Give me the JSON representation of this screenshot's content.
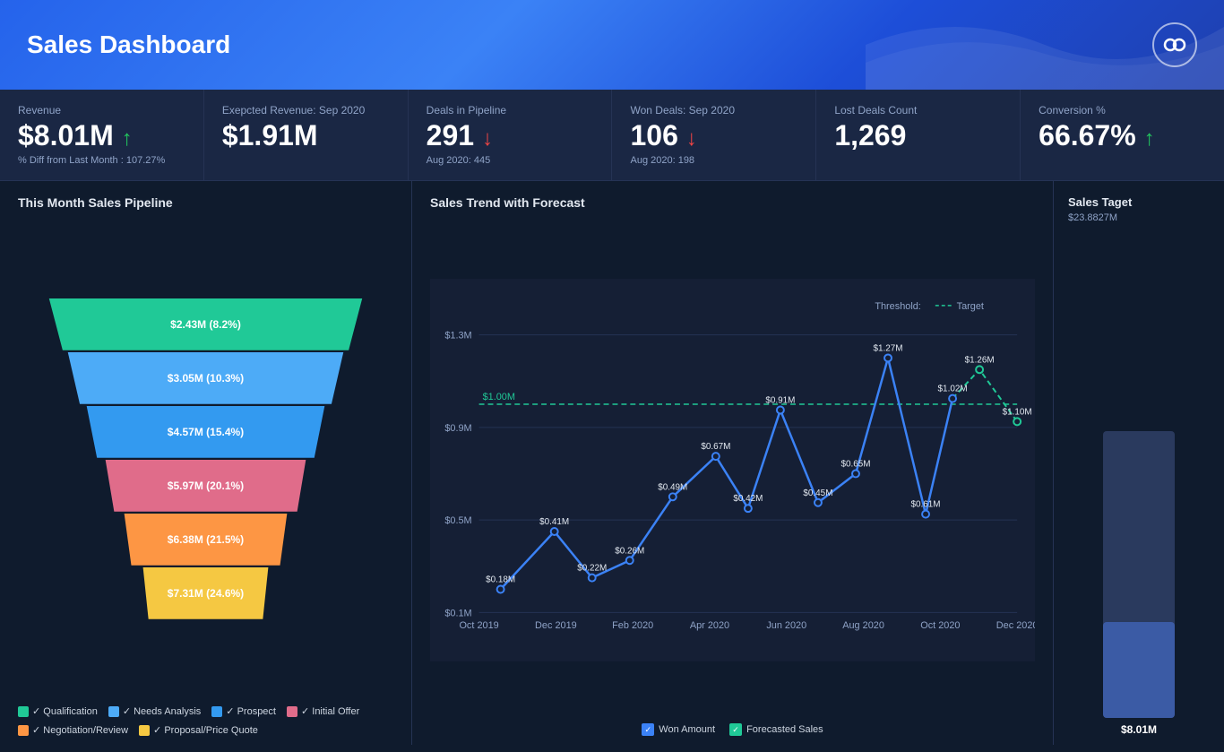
{
  "header": {
    "title": "Sales Dashboard",
    "logo_symbol": "⟳"
  },
  "kpis": [
    {
      "id": "revenue",
      "label": "Revenue",
      "value": "$8.01M",
      "trend": "up",
      "sub": "% Diff from Last Month : 107.27%"
    },
    {
      "id": "expected-revenue",
      "label": "Exepcted Revenue: Sep 2020",
      "value": "$1.91M",
      "trend": "none",
      "sub": ""
    },
    {
      "id": "deals-pipeline",
      "label": "Deals in Pipeline",
      "value": "291",
      "trend": "down",
      "sub": "Aug 2020: 445"
    },
    {
      "id": "won-deals",
      "label": "Won Deals: Sep 2020",
      "value": "106",
      "trend": "down",
      "sub": "Aug 2020: 198"
    },
    {
      "id": "lost-deals",
      "label": "Lost Deals Count",
      "value": "1,269",
      "trend": "none",
      "sub": ""
    },
    {
      "id": "conversion",
      "label": "Conversion %",
      "value": "66.67%",
      "trend": "up",
      "sub": ""
    }
  ],
  "funnel": {
    "title": "This Month Sales Pipeline",
    "bars": [
      {
        "label": "$2.43M (8.2%)",
        "color": "#20c997",
        "width_pct": 100
      },
      {
        "label": "$3.05M (10.3%)",
        "color": "#4dabf7",
        "width_pct": 88
      },
      {
        "label": "$4.57M (15.4%)",
        "color": "#339af0",
        "width_pct": 76
      },
      {
        "label": "$5.97M (20.1%)",
        "color": "#e06c8a",
        "width_pct": 64
      },
      {
        "label": "$6.38M (21.5%)",
        "color": "#fd9644",
        "width_pct": 52
      },
      {
        "label": "$7.31M (24.6%)",
        "color": "#f5c842",
        "width_pct": 40
      }
    ],
    "legend": [
      {
        "label": "Qualification",
        "color": "#20c997"
      },
      {
        "label": "Needs Analysis",
        "color": "#4dabf7"
      },
      {
        "label": "Prospect",
        "color": "#339af0"
      },
      {
        "label": "Initial Offer",
        "color": "#e06c8a"
      },
      {
        "label": "Negotiation/Review",
        "color": "#fd9644"
      },
      {
        "label": "Proposal/Price Quote",
        "color": "#f5c842"
      }
    ]
  },
  "trend": {
    "title": "Sales Trend with Forecast",
    "threshold_label": "Threshold:",
    "target_label": "Target",
    "threshold_value": "$1.00M",
    "x_labels": [
      "Oct 2019",
      "Dec 2019",
      "Feb 2020",
      "Apr 2020",
      "Jun 2020",
      "Aug 2020",
      "Oct 2020",
      "Dec 2020"
    ],
    "y_labels": [
      "$1.3M",
      "$0.9M",
      "$0.5M",
      "$0.1M"
    ],
    "points": [
      {
        "x": 0.04,
        "y": 0.92,
        "label": "$0.18M",
        "type": "actual"
      },
      {
        "x": 0.14,
        "y": 0.72,
        "label": "$0.41M",
        "type": "actual"
      },
      {
        "x": 0.21,
        "y": 0.88,
        "label": "$0.22M",
        "type": "actual"
      },
      {
        "x": 0.28,
        "y": 0.82,
        "label": "$0.26M",
        "type": "actual"
      },
      {
        "x": 0.36,
        "y": 0.6,
        "label": "$0.49M",
        "type": "actual"
      },
      {
        "x": 0.44,
        "y": 0.46,
        "label": "$0.67M",
        "type": "actual"
      },
      {
        "x": 0.5,
        "y": 0.64,
        "label": "$0.42M",
        "type": "actual"
      },
      {
        "x": 0.56,
        "y": 0.3,
        "label": "$0.91M",
        "type": "actual"
      },
      {
        "x": 0.63,
        "y": 0.62,
        "label": "$0.45M",
        "type": "actual"
      },
      {
        "x": 0.7,
        "y": 0.52,
        "label": "$0.65M",
        "type": "actual"
      },
      {
        "x": 0.76,
        "y": 0.12,
        "label": "$1.27M",
        "type": "actual"
      },
      {
        "x": 0.83,
        "y": 0.66,
        "label": "$0.61M",
        "type": "actual"
      },
      {
        "x": 0.88,
        "y": 0.26,
        "label": "$1.02M",
        "type": "actual"
      },
      {
        "x": 0.93,
        "y": 0.16,
        "label": "$1.26M",
        "type": "forecast"
      },
      {
        "x": 1.0,
        "y": 0.34,
        "label": "$1.10M",
        "type": "forecast"
      }
    ],
    "legend": [
      {
        "label": "Won Amount",
        "color": "#3b82f6"
      },
      {
        "label": "Forecasted Sales",
        "color": "#20c997"
      }
    ]
  },
  "target": {
    "title": "Sales Taget",
    "total": "$23.8827M",
    "achieved": "$8.01M",
    "achieved_pct": 33.6
  }
}
